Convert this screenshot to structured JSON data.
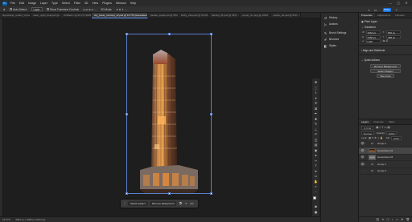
{
  "menu": {
    "logo": "Ps",
    "items": [
      "File",
      "Edit",
      "Image",
      "Layer",
      "Type",
      "Select",
      "Filter",
      "3D",
      "View",
      "Plugins",
      "Window",
      "Help"
    ],
    "window_controls": [
      "—",
      "▢",
      "✕"
    ]
  },
  "options": {
    "auto_select": "Auto-Select:",
    "layer_select": "Layer",
    "show_transform": "Show Transform Controls",
    "mode_3d": "3D Mode:",
    "share": "Share"
  },
  "tabs": [
    {
      "label": "skyscraper_render_v3.psd @ 33.3% (Group 1, RGB/8)",
      "active": false
    },
    {
      "label": "tower_night_final.psd @ 25% (Layer 2, RGB/8)",
      "active": false
    },
    {
      "label": "Untitled-1 @ 66.7% (RGB/8)",
      "active": false
    },
    {
      "label": "city_tower_concept_v2.psd @ 16.7% (Generated Fill, RGB/8#)",
      "active": true
    },
    {
      "label": "facade_detail.psd @ 50%",
      "active": false
    },
    {
      "label": "lobby_view.psd @ 33.3%",
      "active": false
    },
    {
      "label": "backup_01.psd @ 25%",
      "active": false
    },
    {
      "label": "export_sm.png @ 100%",
      "active": false
    },
    {
      "label": "rooftop_alt.psd @ 50%",
      "active": false
    }
  ],
  "status": {
    "zoom": "16.67%",
    "doc": "3000 px x 4000 px (300 ppi)"
  },
  "taskbar": {
    "select_subject": "Select subject",
    "remove_background": "Remove background",
    "more": "•••"
  },
  "midpanel": {
    "items": [
      {
        "icon": "history-icon",
        "glyph": "↺",
        "label": "History"
      },
      {
        "icon": "actions-icon",
        "glyph": "▷",
        "label": "Actions"
      },
      {
        "icon": "brush-settings-icon",
        "glyph": "✎",
        "label": "Brush Settings"
      },
      {
        "icon": "brushes-icon",
        "glyph": "✐",
        "label": "Brushes"
      },
      {
        "icon": "styles-icon",
        "glyph": "◧",
        "label": "Styles"
      }
    ]
  },
  "properties": {
    "tabs": [
      "Properties",
      "Adjustments",
      "Libraries"
    ],
    "layer_kind": "Pixel Layer",
    "transform_title": "Transform",
    "w_label": "W",
    "w_value": "1664 px",
    "h_label": "H",
    "h_value": "3456 px",
    "x_label": "X",
    "x_value": "656 px",
    "y_label": "Y",
    "y_value": "288 px",
    "angle_label": "∠",
    "angle_value": "0.00°",
    "align_title": "Align and Distribute",
    "quick_actions_title": "Quick Actions",
    "quick_actions": [
      "Remove Background",
      "Select Subject",
      "See more"
    ]
  },
  "layers": {
    "tabs": [
      "Layers",
      "Channels",
      "Paths"
    ],
    "kind": "Q Kind",
    "blend": "Normal",
    "opacity_label": "Opacity:",
    "opacity": "100%",
    "lock_label": "Lock:",
    "fill_label": "Fill:",
    "fill": "100%",
    "rows": [
      {
        "name": "Group 2",
        "type": "folder",
        "visible": true,
        "selected": false
      },
      {
        "name": "Generative Fill",
        "type": "img",
        "visible": true,
        "selected": true
      },
      {
        "name": "Generative Fill",
        "type": "img2",
        "visible": true,
        "selected": false
      },
      {
        "name": "Group 1",
        "type": "folder",
        "visible": true,
        "selected": false
      },
      {
        "name": "Group 3",
        "type": "folder",
        "visible": false,
        "selected": false
      }
    ],
    "bottom_icons": [
      "link-icon",
      "fx-icon",
      "mask-icon",
      "adjustment-icon",
      "folder-icon",
      "new-layer-icon",
      "trash-icon"
    ]
  },
  "colors": {
    "accent": "#1473e6",
    "selection": "#5a7fd0",
    "tower_glow": "#e08a3c"
  }
}
